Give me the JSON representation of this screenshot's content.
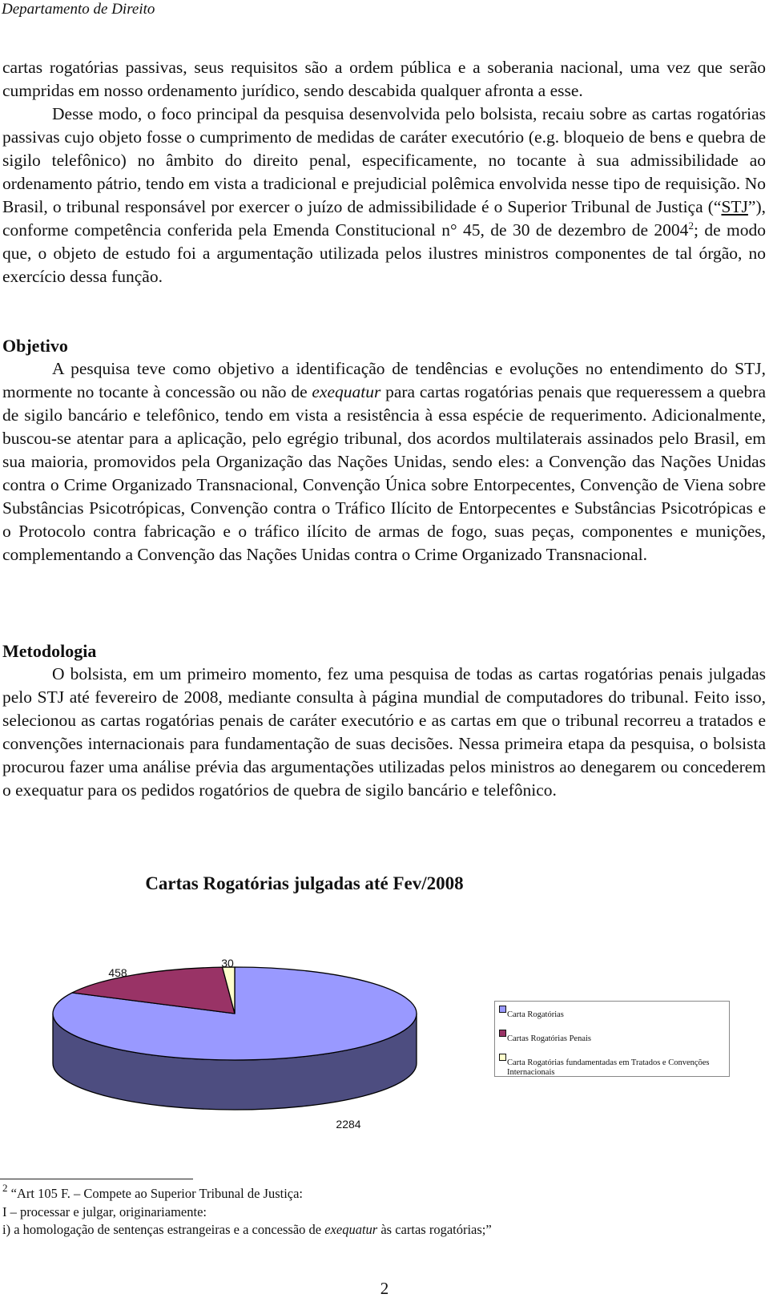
{
  "header": {
    "department": "Departamento de Direito"
  },
  "intro": {
    "p1": "cartas rogatórias passivas, seus requisitos são a ordem pública e a soberania nacional, uma vez que serão cumpridas em nosso ordenamento jurídico, sendo descabida qualquer afronta a esse.",
    "p2_before_stj": "Desse modo, o foco principal da pesquisa desenvolvida pelo bolsista, recaiu sobre as cartas rogatórias passivas cujo objeto fosse o cumprimento de medidas de caráter executório (e.g. bloqueio de bens e quebra de sigilo telefônico) no âmbito do direito penal, especificamente, no tocante à sua admissibilidade ao ordenamento pátrio, tendo em vista a tradicional e prejudicial polêmica envolvida nesse tipo de requisição. No Brasil, o tribunal responsável por exercer o juízo de admissibilidade é o Superior Tribunal de Justiça (“",
    "p2_stj": "STJ",
    "p2_after_stj": "”), conforme competência conferida pela Emenda Constitucional n° 45, de 30 de dezembro de 2004",
    "p2_footnote_ref": "2",
    "p2_end": "; de modo que, o objeto de estudo foi a argumentação utilizada pelos ilustres ministros componentes de tal órgão, no exercício dessa função."
  },
  "objetivo": {
    "heading": "Objetivo",
    "text_before": "A pesquisa teve como objetivo a identificação de tendências e evoluções no entendimento do STJ, mormente no tocante à concessão ou não de ",
    "text_italic": "exequatur",
    "text_after": " para cartas rogatórias penais que requeressem a quebra de sigilo bancário e telefônico, tendo em vista a resistência à essa espécie de requerimento. Adicionalmente, buscou-se atentar para a aplicação, pelo egrégio tribunal, dos acordos multilaterais assinados pelo Brasil, em sua maioria, promovidos pela Organização das Nações Unidas, sendo eles: a Convenção das Nações Unidas contra o Crime Organizado Transnacional, Convenção Única sobre Entorpecentes, Convenção de Viena sobre Substâncias Psicotrópicas, Convenção contra o Tráfico Ilícito de Entorpecentes e Substâncias Psicotrópicas e o Protocolo contra fabricação e o tráfico ilícito de armas de fogo, suas peças, componentes e munições, complementando a Convenção das Nações Unidas contra o Crime Organizado Transnacional."
  },
  "metodologia": {
    "heading": "Metodologia",
    "text": "O bolsista, em um primeiro momento, fez uma pesquisa de todas as cartas rogatórias penais julgadas pelo STJ até fevereiro de 2008, mediante consulta à página mundial de computadores do tribunal. Feito isso, selecionou as cartas rogatórias penais de caráter executório e as cartas em que o tribunal recorreu a tratados e convenções internacionais para fundamentação de suas decisões. Nessa primeira etapa da pesquisa, o bolsista procurou fazer uma análise prévia das argumentações utilizadas pelos ministros ao denegarem ou concederem o exequatur para os pedidos rogatórios de quebra de sigilo bancário e telefônico."
  },
  "chart_data": {
    "type": "pie",
    "style": "3d",
    "title": "Cartas Rogatórias julgadas até Fev/2008",
    "categories": [
      "Carta Rogatórias",
      "Cartas Rogatórias Penais",
      "Carta Rogatórias fundamentadas em Tratados e Convenções Internacionais"
    ],
    "values": [
      2284,
      458,
      30
    ],
    "data_labels": [
      "2284",
      "458",
      "30"
    ],
    "colors": [
      "#9999ff",
      "#993366",
      "#ffffcc"
    ],
    "side_colors": [
      "#4d4d80",
      "#4d1a33",
      "#80806a"
    ],
    "legend_position": "right"
  },
  "footnote": {
    "marker": "2",
    "line1": " “Art 105 F. – Compete ao Superior Tribunal de Justiça:",
    "line2": "I – processar e julgar, originariamente:",
    "line3_before": "i) a homologação de sentenças estrangeiras e a concessão de ",
    "line3_italic": "exequatur",
    "line3_after": " às cartas rogatórias;”"
  },
  "page_number": "2"
}
